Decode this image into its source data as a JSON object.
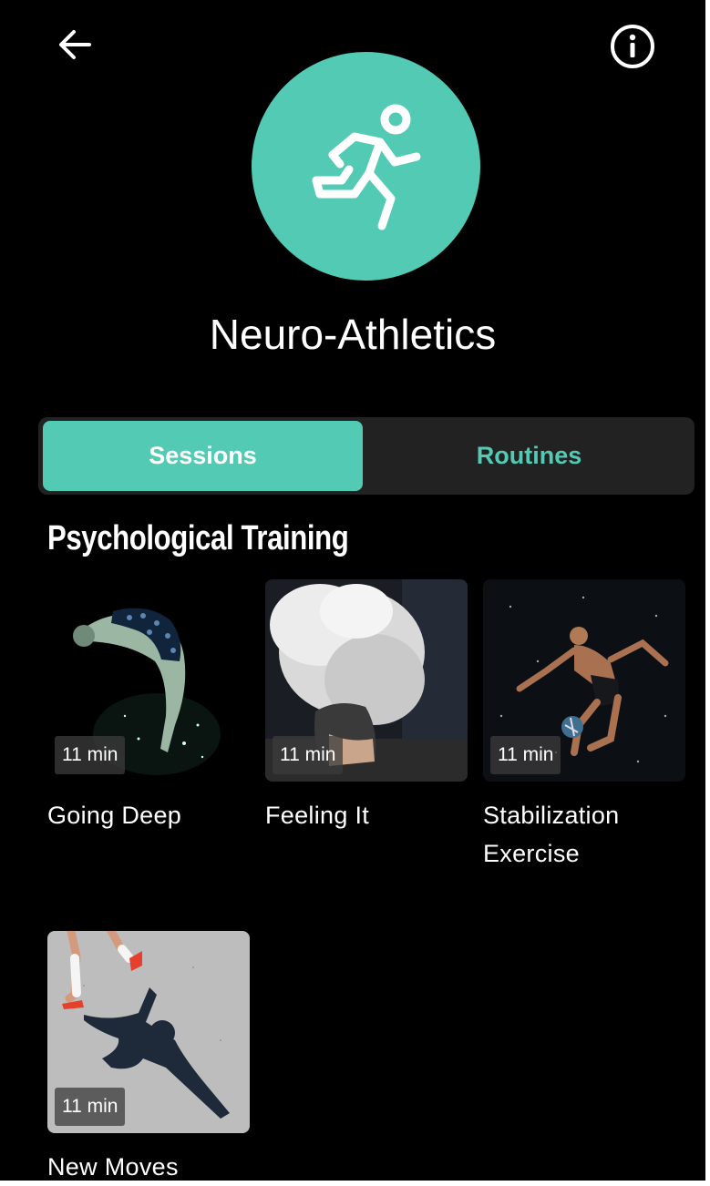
{
  "header": {
    "back_icon": "arrow-left-icon",
    "info_icon": "info-circle-icon"
  },
  "hero": {
    "icon": "running-person-icon",
    "accent": "#53cbb4",
    "title": "Neuro-Athletics"
  },
  "tabs": [
    {
      "label": "Sessions",
      "active": true
    },
    {
      "label": "Routines",
      "active": false
    }
  ],
  "section": {
    "title": "Psychological Training"
  },
  "sessions": [
    {
      "title": "Going Deep",
      "duration": "11 min"
    },
    {
      "title": "Feeling It",
      "duration": "11 min"
    },
    {
      "title": "Stabilization Exercise",
      "duration": "11 min"
    },
    {
      "title": "New Moves",
      "duration": "11 min"
    }
  ]
}
